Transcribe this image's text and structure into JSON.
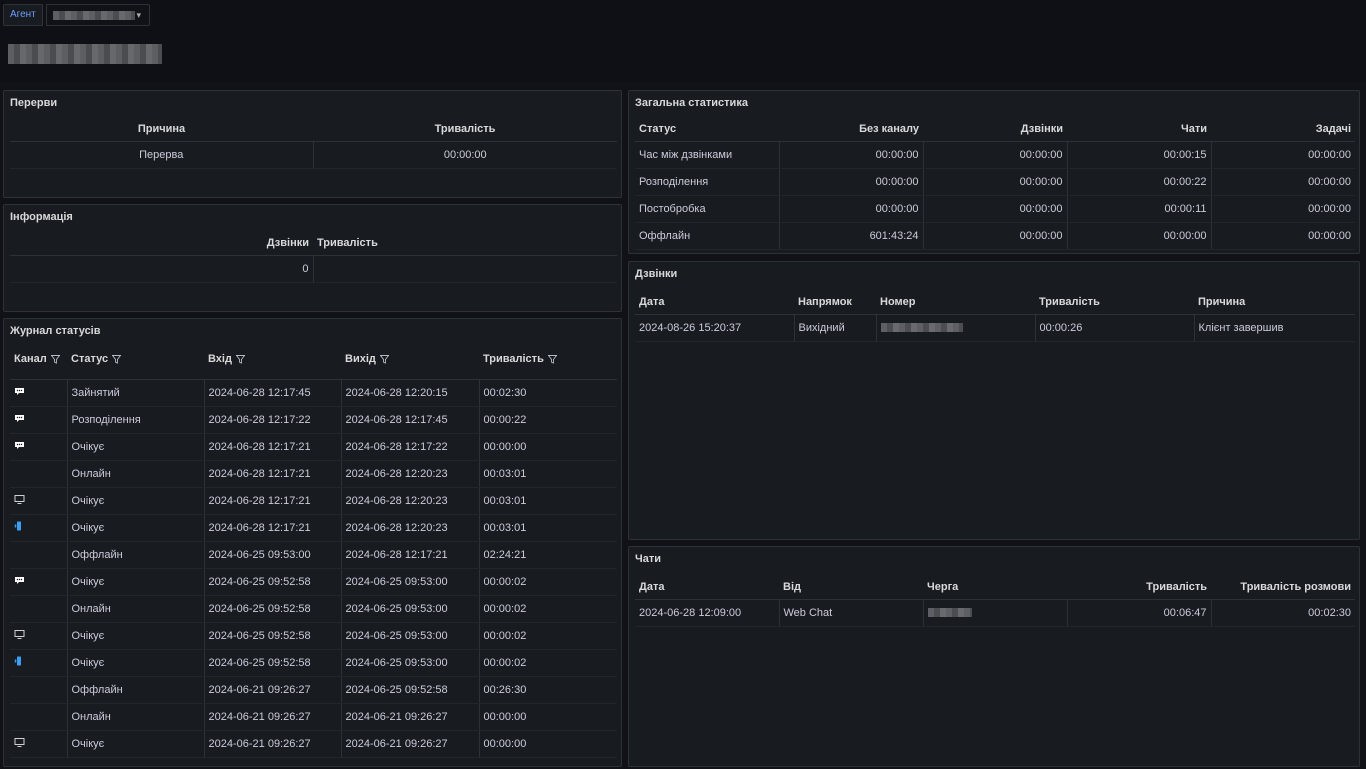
{
  "header": {
    "variable_label": "Агент"
  },
  "breaks": {
    "title": "Перерви",
    "columns": [
      "Причина",
      "Тривалість"
    ],
    "rows": [
      [
        "Перерва",
        "00:00:00"
      ]
    ]
  },
  "info": {
    "title": "Інформація",
    "columns": [
      "Дзвінки",
      "Тривалість"
    ],
    "rows": [
      [
        "0",
        ""
      ]
    ]
  },
  "status_log": {
    "title": "Журнал статусів",
    "columns": [
      "Канал",
      "Статус",
      "Вхід",
      "Вихід",
      "Тривалість"
    ],
    "rows": [
      {
        "channel": "chat-icon",
        "status": "Зайнятий",
        "in": "2024-06-28 12:17:45",
        "out": "2024-06-28 12:20:15",
        "duration": "00:02:30"
      },
      {
        "channel": "chat-icon",
        "status": "Розподілення",
        "in": "2024-06-28 12:17:22",
        "out": "2024-06-28 12:17:45",
        "duration": "00:00:22"
      },
      {
        "channel": "chat-icon",
        "status": "Очікує",
        "in": "2024-06-28 12:17:21",
        "out": "2024-06-28 12:17:22",
        "duration": "00:00:00"
      },
      {
        "channel": "",
        "status": "Онлайн",
        "in": "2024-06-28 12:17:21",
        "out": "2024-06-28 12:20:23",
        "duration": "00:03:01"
      },
      {
        "channel": "monitor-icon",
        "status": "Очікує",
        "in": "2024-06-28 12:17:21",
        "out": "2024-06-28 12:20:23",
        "duration": "00:03:01"
      },
      {
        "channel": "phone-icon",
        "status": "Очікує",
        "in": "2024-06-28 12:17:21",
        "out": "2024-06-28 12:20:23",
        "duration": "00:03:01"
      },
      {
        "channel": "",
        "status": "Оффлайн",
        "in": "2024-06-25 09:53:00",
        "out": "2024-06-28 12:17:21",
        "duration": "02:24:21"
      },
      {
        "channel": "chat-icon",
        "status": "Очікує",
        "in": "2024-06-25 09:52:58",
        "out": "2024-06-25 09:53:00",
        "duration": "00:00:02"
      },
      {
        "channel": "",
        "status": "Онлайн",
        "in": "2024-06-25 09:52:58",
        "out": "2024-06-25 09:53:00",
        "duration": "00:00:02"
      },
      {
        "channel": "monitor-icon",
        "status": "Очікує",
        "in": "2024-06-25 09:52:58",
        "out": "2024-06-25 09:53:00",
        "duration": "00:00:02"
      },
      {
        "channel": "phone-icon",
        "status": "Очікує",
        "in": "2024-06-25 09:52:58",
        "out": "2024-06-25 09:53:00",
        "duration": "00:00:02"
      },
      {
        "channel": "",
        "status": "Оффлайн",
        "in": "2024-06-21 09:26:27",
        "out": "2024-06-25 09:52:58",
        "duration": "00:26:30"
      },
      {
        "channel": "",
        "status": "Онлайн",
        "in": "2024-06-21 09:26:27",
        "out": "2024-06-21 09:26:27",
        "duration": "00:00:00"
      },
      {
        "channel": "monitor-icon",
        "status": "Очікує",
        "in": "2024-06-21 09:26:27",
        "out": "2024-06-21 09:26:27",
        "duration": "00:00:00"
      }
    ]
  },
  "general_stats": {
    "title": "Загальна статистика",
    "columns": [
      "Статус",
      "Без каналу",
      "Дзвінки",
      "Чати",
      "Задачі"
    ],
    "rows": [
      [
        "Час між дзвінками",
        "00:00:00",
        "00:00:00",
        "00:00:15",
        "00:00:00"
      ],
      [
        "Розподілення",
        "00:00:00",
        "00:00:00",
        "00:00:22",
        "00:00:00"
      ],
      [
        "Постобробка",
        "00:00:00",
        "00:00:00",
        "00:00:11",
        "00:00:00"
      ],
      [
        "Оффлайн",
        "601:43:24",
        "00:00:00",
        "00:00:00",
        "00:00:00"
      ]
    ]
  },
  "calls": {
    "title": "Дзвінки",
    "columns": [
      "Дата",
      "Напрямок",
      "Номер",
      "Тривалість",
      "Причина"
    ],
    "rows": [
      [
        "2024-08-26 15:20:37",
        "Вихідний",
        "",
        "00:00:26",
        "Клієнт завершив"
      ]
    ]
  },
  "chats": {
    "title": "Чати",
    "columns": [
      "Дата",
      "Від",
      "Черга",
      "Тривалість",
      "Тривалість розмови"
    ],
    "rows": [
      [
        "2024-06-28 12:09:00",
        "Web Chat",
        "",
        "00:06:47",
        "00:02:30"
      ]
    ]
  },
  "colors": {
    "background": "#111217",
    "panel": "#181b1f",
    "border": "#2c3235",
    "accent": "#6e9fff",
    "phone_icon": "#3d9df2"
  }
}
